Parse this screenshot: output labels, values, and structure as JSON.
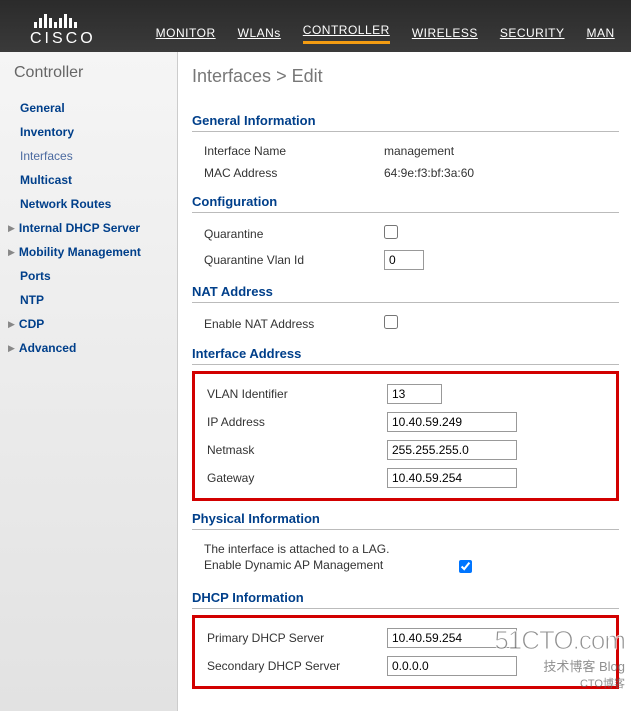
{
  "brand": "CISCO",
  "topnav": {
    "monitor": "MONITOR",
    "wlans": "WLANs",
    "controller": "CONTROLLER",
    "wireless": "WIRELESS",
    "security": "SECURITY",
    "man": "MAN"
  },
  "sidebar": {
    "title": "Controller",
    "items": {
      "general": "General",
      "inventory": "Inventory",
      "interfaces": "Interfaces",
      "multicast": "Multicast",
      "network_routes": "Network Routes",
      "internal_dhcp": "Internal DHCP Server",
      "mobility": "Mobility Management",
      "ports": "Ports",
      "ntp": "NTP",
      "cdp": "CDP",
      "advanced": "Advanced"
    }
  },
  "breadcrumb": {
    "root": "Interfaces",
    "sep": ">",
    "tail": "Edit"
  },
  "sections": {
    "general_info": {
      "title": "General Information",
      "interface_name_label": "Interface Name",
      "interface_name_value": "management",
      "mac_label": "MAC Address",
      "mac_value": "64:9e:f3:bf:3a:60"
    },
    "configuration": {
      "title": "Configuration",
      "quarantine_label": "Quarantine",
      "quarantine_vlan_label": "Quarantine Vlan Id",
      "quarantine_vlan_value": "0"
    },
    "nat": {
      "title": "NAT Address",
      "enable_nat_label": "Enable NAT Address"
    },
    "iface_addr": {
      "title": "Interface Address",
      "vlan_label": "VLAN Identifier",
      "vlan_value": "13",
      "ip_label": "IP Address",
      "ip_value": "10.40.59.249",
      "netmask_label": "Netmask",
      "netmask_value": "255.255.255.0",
      "gateway_label": "Gateway",
      "gateway_value": "10.40.59.254"
    },
    "physical": {
      "title": "Physical Information",
      "note_line1": "The interface is attached to a LAG.",
      "note_line2": "Enable Dynamic AP Management"
    },
    "dhcp": {
      "title": "DHCP Information",
      "primary_label": "Primary DHCP Server",
      "primary_value": "10.40.59.254",
      "secondary_label": "Secondary DHCP Server",
      "secondary_value": "0.0.0.0"
    }
  },
  "watermark": {
    "main": "51CTO.com",
    "sub": "技术博客   Blog",
    "sub2": "CTO博客"
  }
}
